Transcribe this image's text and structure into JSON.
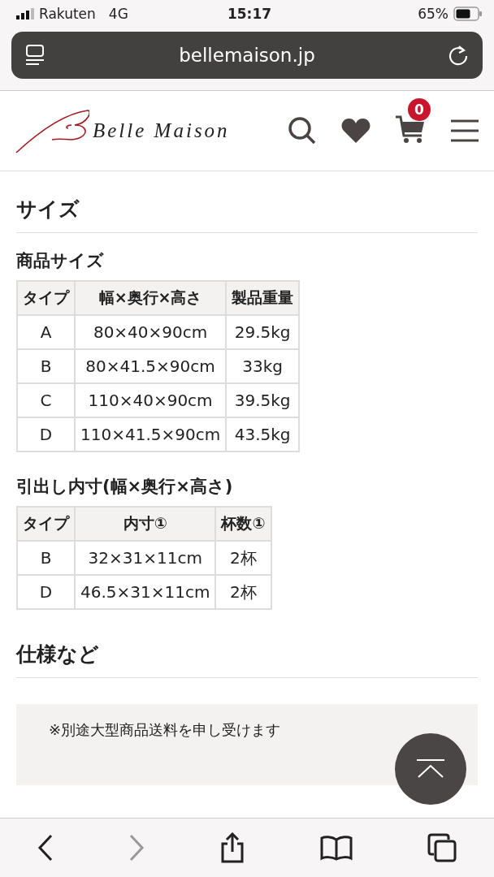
{
  "status_bar": {
    "carrier": "Rakuten",
    "network": "4G",
    "time": "15:17",
    "battery": "65%"
  },
  "address_bar": {
    "url": "bellemaison.jp"
  },
  "header": {
    "brand": "Belle Maison",
    "cart_count": "0"
  },
  "sections": [
    {
      "title": "サイズ",
      "tables": [
        {
          "title": "商品サイズ",
          "columns": [
            "タイプ",
            "幅×奥行×高さ",
            "製品重量"
          ],
          "rows": [
            [
              "A",
              "80×40×90cm",
              "29.5kg"
            ],
            [
              "B",
              "80×41.5×90cm",
              "33kg"
            ],
            [
              "C",
              "110×40×90cm",
              "39.5kg"
            ],
            [
              "D",
              "110×41.5×90cm",
              "43.5kg"
            ]
          ]
        },
        {
          "title": "引出し内寸(幅×奥行×高さ)",
          "columns": [
            "タイプ",
            "内寸①",
            "杯数①"
          ],
          "rows": [
            [
              "B",
              "32×31×11cm",
              "2杯"
            ],
            [
              "D",
              "46.5×31×11cm",
              "2杯"
            ]
          ]
        }
      ]
    },
    {
      "title": "仕様など",
      "note": "※別途大型商品送料を申し受けます"
    }
  ]
}
